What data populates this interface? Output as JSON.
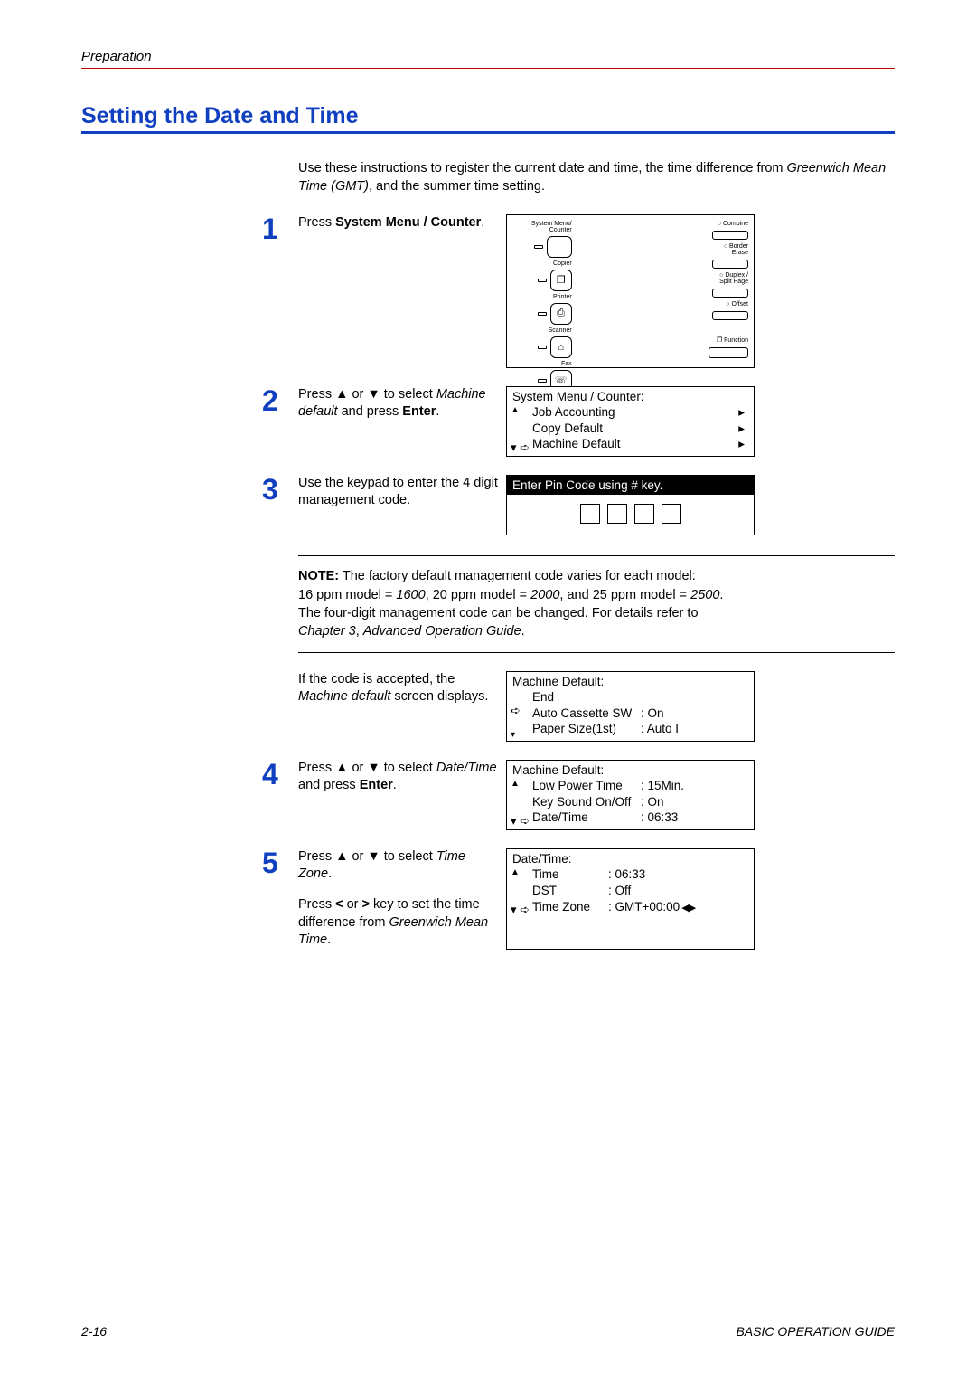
{
  "header": {
    "section": "Preparation"
  },
  "title": "Setting the Date and Time",
  "intro": {
    "line1": "Use these instructions to register the current date and time, the time difference from ",
    "line1_ital": "Greenwich Mean Time (GMT)",
    "line1_end": ", and the summer time setting."
  },
  "steps": {
    "s1": {
      "num": "1",
      "t1": "Press ",
      "t1_bold": "System Menu / Counter",
      "t1_end": "."
    },
    "s2": {
      "num": "2",
      "t1": "Press ▲ or ▼ to select ",
      "t2_ital": "Machine default",
      "t3": " and press ",
      "t3_bold": "Enter",
      "t4": "."
    },
    "s3": {
      "num": "3",
      "t1": "Use the keypad to enter the 4 digit management code."
    },
    "s4": {
      "num": "4",
      "t1": "Press ▲ or ▼ to select ",
      "t2_ital": "Date/Time",
      "t3": " and press ",
      "t3_bold": "Enter",
      "t4": "."
    },
    "s5": {
      "num": "5",
      "t1a": "Press ▲ or ▼ to select ",
      "t1b_ital": "Time Zone",
      "t1c": ".",
      "p2a": "Press ",
      "p2b_bold": "<",
      "p2c": " or ",
      "p2d_bold": ">",
      "p2e": " key to set the time difference from ",
      "p2f_ital": "Greenwich Mean Time",
      "p2g": "."
    }
  },
  "note": {
    "lead_bold": "NOTE:",
    "line1": " The factory default management code varies for each model:",
    "line2a": "16 ppm model = ",
    "line2a_it": "1600",
    "line2b": ", 20 ppm model = ",
    "line2b_it": "2000",
    "line2c": ", and 25 ppm model = ",
    "line2c_it": "2500",
    "line2d": ".",
    "line3": "The four-digit management code can be changed. For details refer to ",
    "line3_it": "Chapter 3",
    "line3_mid": ", ",
    "line3_it2": "Advanced Operation Guide",
    "line3_end": "."
  },
  "accepted": {
    "t1": "If the code is accepted, the ",
    "t2_ital": "Machine default",
    "t3": " screen displays."
  },
  "ctrl": {
    "sm": "System Menu/\nCounter",
    "copier": "Copier",
    "printer": "Printer",
    "scanner": "Scanner",
    "fax": "Fax",
    "combine": "Combine",
    "border": "Border\nErase",
    "duplex": "Duplex /\nSplit Page",
    "offset": "Offset",
    "func": "Function"
  },
  "disp2": {
    "title": "System Menu / Counter:",
    "l1": "Job Accounting",
    "l2": "Copy Default",
    "l3": "Machine Default"
  },
  "disp3": {
    "bar": "Enter Pin Code using # key."
  },
  "disp_accept": {
    "title": "Machine Default:",
    "l1": "End",
    "l2k": "Auto Cassette SW",
    "l2v": "On",
    "l3k": "Paper Size(1st)",
    "l3v": "Auto I"
  },
  "disp4": {
    "title": "Machine Default:",
    "l1k": "Low Power Time",
    "l1v": "15Min.",
    "l2k": "Key Sound On/Off",
    "l2v": "On",
    "l3k": "Date/Time",
    "l3v": "06:33"
  },
  "disp5": {
    "title": "Date/Time:",
    "l1k": "Time",
    "l1v": "06:33",
    "l2k": "DST",
    "l2v": "Off",
    "l3k": "Time Zone",
    "l3v": "GMT+00:00"
  },
  "footer": {
    "left": "2-16",
    "right": "BASIC OPERATION GUIDE"
  }
}
